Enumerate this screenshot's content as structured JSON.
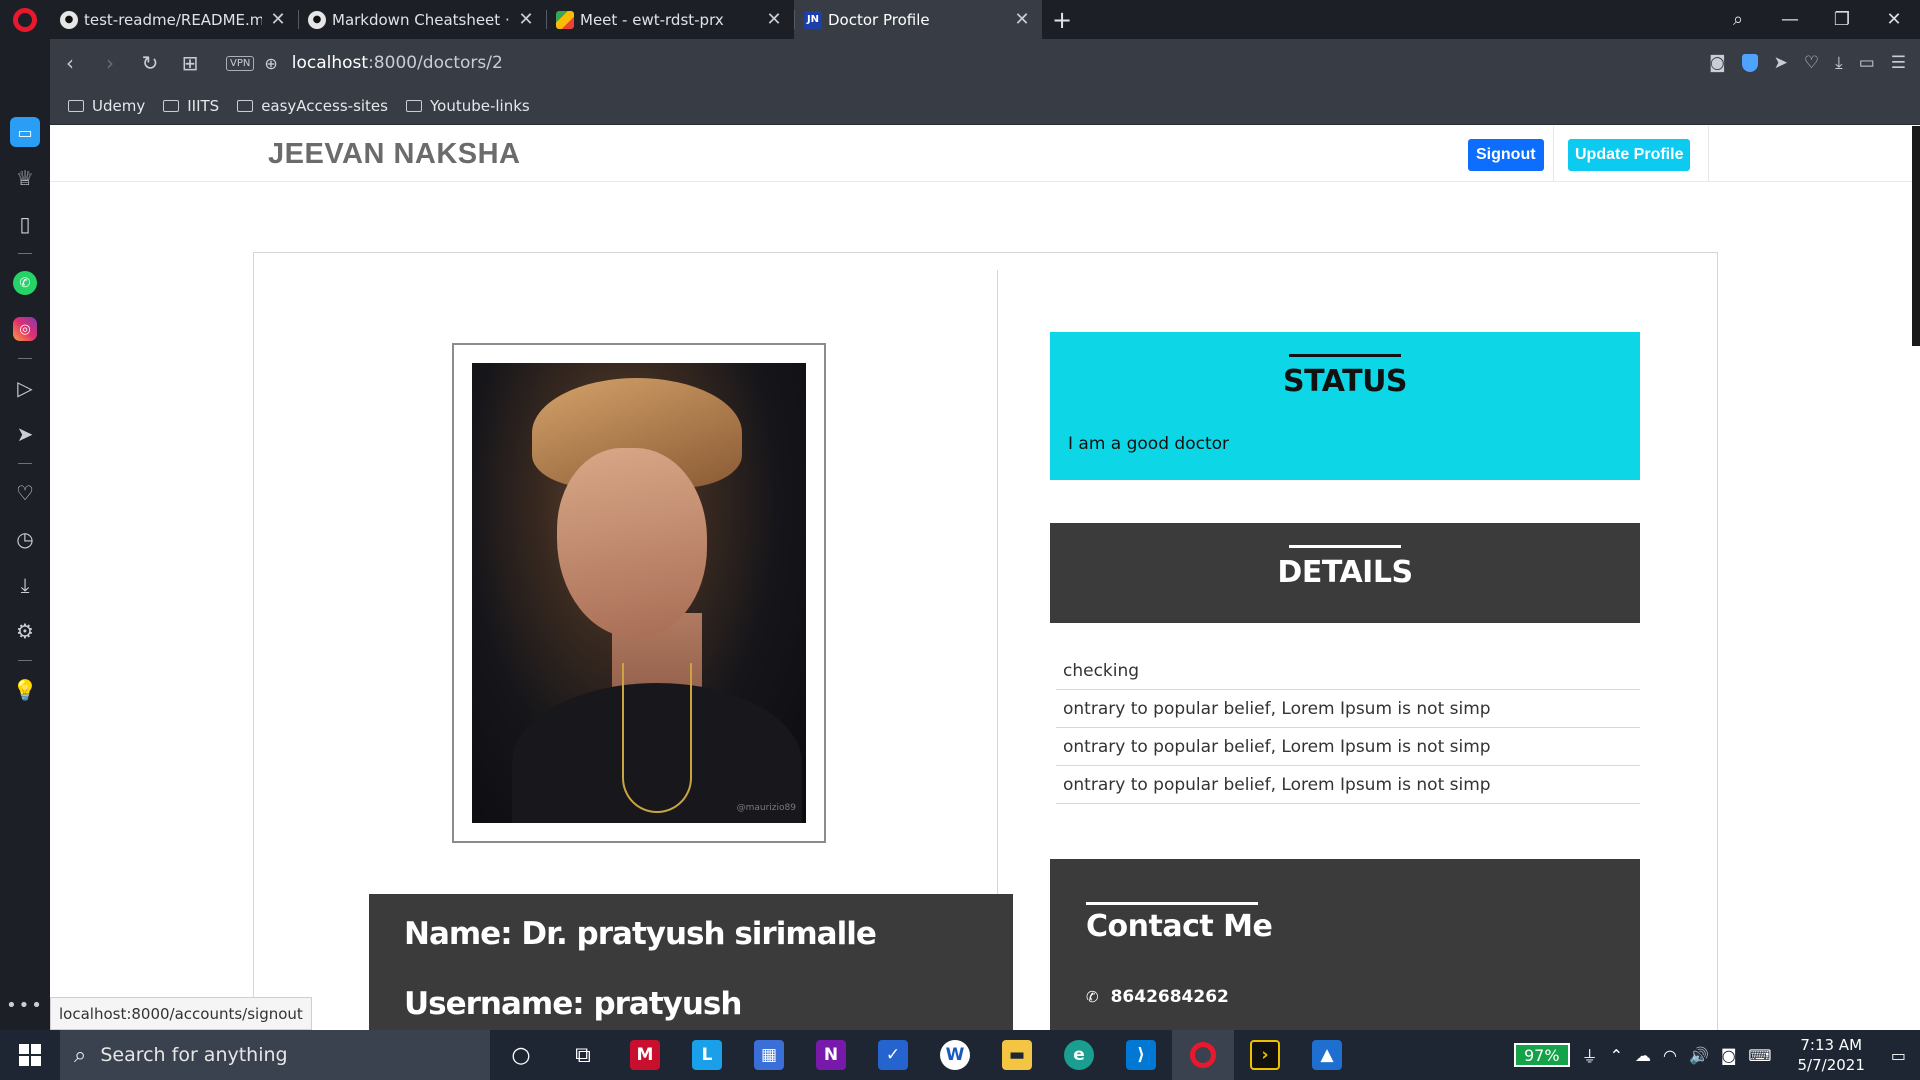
{
  "browser": {
    "tabs": [
      {
        "label": "test-readme/README.md a",
        "icon": "github-icon",
        "active": false
      },
      {
        "label": "Markdown Cheatsheet · ad",
        "icon": "github-icon",
        "active": false
      },
      {
        "label": "Meet - ewt-rdst-prx",
        "icon": "google-meet-icon",
        "active": false
      },
      {
        "label": "Doctor Profile",
        "icon": "jn-favicon",
        "active": true
      }
    ],
    "favicon_jn": "JN",
    "url_host": "localhost",
    "url_rest": ":8000/doctors/2",
    "vpn_label": "VPN",
    "bookmarks": [
      "Udemy",
      "IIITS",
      "easyAccess-sites",
      "Youtube-links"
    ]
  },
  "page": {
    "brand": "JEEVAN NAKSHA",
    "signout_label": "Signout",
    "update_label": "Update Profile",
    "photo_watermark": "@maurizio89",
    "name_line": "Name: Dr. pratyush sirimalle",
    "username_line": "Username: pratyush",
    "status": {
      "heading": "STATUS",
      "text": "I am a good doctor"
    },
    "details": {
      "heading": "DETAILS",
      "items": [
        "checking",
        "ontrary to popular belief, Lorem Ipsum is not simp",
        "ontrary to popular belief, Lorem Ipsum is not simp",
        "ontrary to popular belief, Lorem Ipsum is not simp"
      ]
    },
    "contact": {
      "heading": "Contact Me",
      "phone": "8642684262"
    },
    "status_bar_url": "localhost:8000/accounts/signout"
  },
  "taskbar": {
    "search_placeholder": "Search for anything",
    "battery": "97%",
    "time": "7:13 AM",
    "date": "5/7/2021"
  },
  "colors": {
    "status_bg": "#0dd7e6",
    "dark_box_bg": "#3b3b3b",
    "signout_bg": "#0d6efd",
    "update_bg": "#0dcaf0"
  }
}
